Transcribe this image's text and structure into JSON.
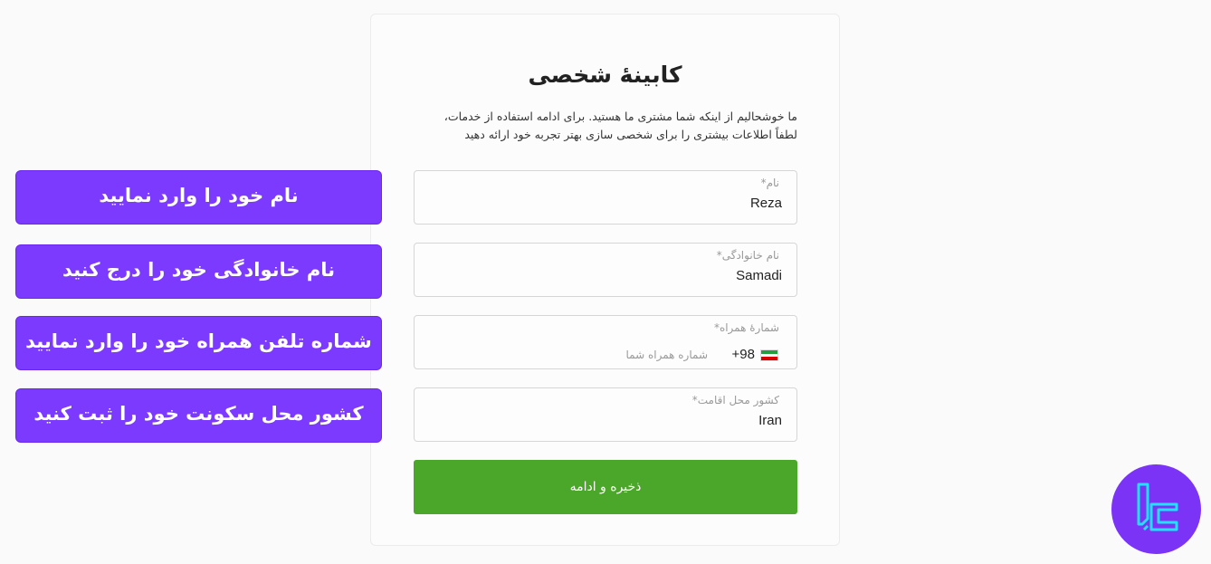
{
  "card": {
    "title": "کابینهٔ شخصی",
    "intro_line1": "ما خوشحالیم از اینکه شما مشتری ما هستید. برای ادامه استفاده از خدمات،",
    "intro_line2": "لطفاً اطلاعات بیشتری را برای شخصی سازی بهتر تجربه خود ارائه دهید"
  },
  "form": {
    "first_name": {
      "label": "نام*",
      "value": "Reza"
    },
    "last_name": {
      "label": "نام خانوادگی*",
      "value": "Samadi"
    },
    "phone": {
      "label": "شمارهٔ همراه*",
      "dial_code": "+98",
      "placeholder": "شماره همراه شما",
      "flag_icon": "iran-flag-icon"
    },
    "country": {
      "label": "کشور محل اقامت*",
      "value": "Iran"
    },
    "submit_label": "ذخیره و ادامه"
  },
  "annotations": [
    "نام خود را وارد نمایید",
    "نام خانوادگی خود را درج کنید",
    "شماره تلفن همراه خود را وارد نمایید",
    "کشور محل سکونت خود را ثبت کنید"
  ],
  "colors": {
    "submit": "#4aa729",
    "annotation": "#7c3aff",
    "logo_bg": "#7b33f5",
    "logo_fg": "#22e0ff"
  },
  "logo": {
    "icon": "brand-logo-icon"
  }
}
